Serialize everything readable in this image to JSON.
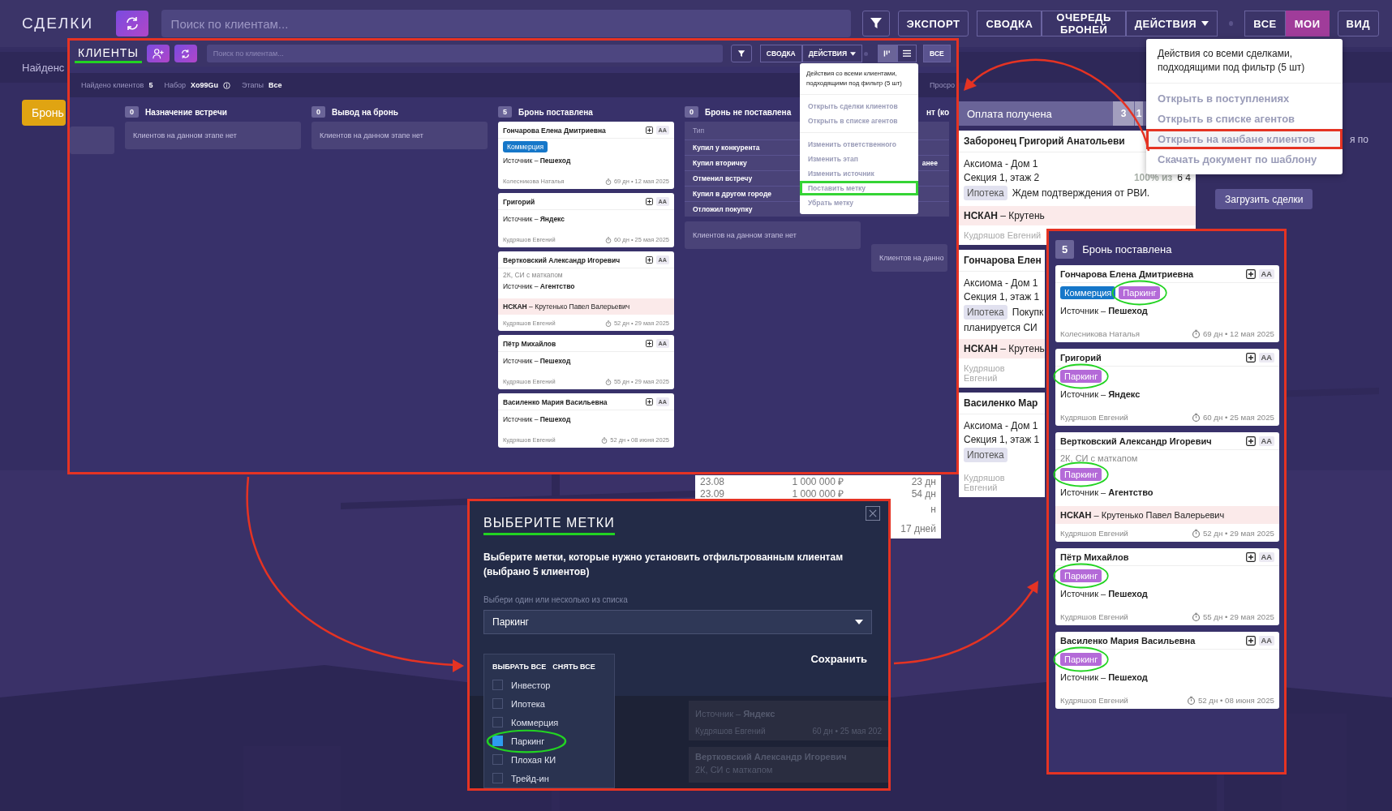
{
  "top_bar": {
    "title": "СДЕЛКИ",
    "search": {
      "placeholder": "Поиск по клиентам..."
    },
    "export": "ЭКСПОРТ",
    "group": [
      {
        "label": "СВОДКА",
        "kind": "plain"
      },
      {
        "label": "ОЧЕРЕДЬ БРОНЕЙ",
        "kind": "plain"
      },
      {
        "label": "ДЕЙСТВИЯ",
        "kind": "dropdown"
      }
    ],
    "scope_tabs": [
      {
        "label": "ВСЕ",
        "selected": false
      },
      {
        "label": "МОИ",
        "selected": true
      }
    ],
    "view": "ВИД"
  },
  "background": {
    "found_fragment": "Найденс",
    "stage_button": "Бронь",
    "side_fragment": "я по",
    "load_button": "Загрузить сделки",
    "payments": [
      [
        "23.08",
        "1 000 000 ₽",
        "23 дн"
      ],
      [
        "23.09",
        "1 000 000 ₽",
        "54 дн"
      ]
    ],
    "payments_fragment": "н",
    "payments_total": "17 дней"
  },
  "deals_menu": {
    "header": "Действия со всеми сделками, подходящими под фильтр (5 шт)",
    "items": [
      {
        "label": "Открыть в поступлениях",
        "highlighted": false
      },
      {
        "label": "Открыть в списке агентов",
        "highlighted": false
      },
      {
        "label": "Открыть на канбане клиентов",
        "highlighted": true
      },
      {
        "label": "Скачать документ по шаблону",
        "highlighted": false
      }
    ]
  },
  "deal_column": {
    "title": "Оплата получена",
    "counts": [
      "3",
      "1"
    ],
    "cards": [
      {
        "name": "Заборонец Григорий Анатольеви",
        "lines": [
          "Аксиома - Дом 1",
          "Секция 1, этаж 2"
        ],
        "progress": "100% из",
        "amount": "6 4",
        "tag": "Ипотека",
        "comment": "Ждем подтверждения от РВИ.",
        "nskan": "**НСКАН** – Крутень",
        "manager": "Кудряшов Евгений"
      },
      {
        "name": "Гончарова Елен",
        "lines": [
          "Аксиома - Дом 1",
          "Секция 1, этаж 1"
        ],
        "tag": "Ипотека",
        "comment": "Покупк",
        "comment_2": "планируется СИ",
        "nskan": "**НСКАН** – Крутень",
        "manager": "Кудряшов Евгений"
      },
      {
        "name": "Василенко Мар",
        "lines": [
          "Аксиома - Дом 1",
          "Секция 1, этаж 1"
        ],
        "tag": "Ипотека",
        "manager": "Кудряшов Евгений"
      }
    ]
  },
  "clients_panel": {
    "title": "КЛИЕНТЫ",
    "title_underlined": true,
    "search": {
      "placeholder": "Поиск по клиентам..."
    },
    "summary": "СВОДКА",
    "actions": "ДЕЙСТВИЯ",
    "view_toggle": [
      {
        "kind": "kanban",
        "selected": true
      },
      {
        "kind": "list",
        "selected": false
      }
    ],
    "scope": "ВСЕ",
    "info": [
      {
        "label": "Найдено клиентов",
        "value": "5"
      },
      {
        "label": "Набор",
        "value": "Xo99Gu",
        "info_icon": true
      },
      {
        "label": "Этапы",
        "value": "Все"
      }
    ],
    "info_fragment": "Просро",
    "menu": {
      "header": "Действия со всеми клиентами, подходящими под фильтр (5 шт)",
      "groups": [
        [
          {
            "label": "Открыть сделки клиентов",
            "highlighted": false
          },
          {
            "label": "Открыть в списке агентов",
            "highlighted": false
          }
        ],
        [
          {
            "label": "Изменить ответственного",
            "highlighted": false
          },
          {
            "label": "Изменить этап",
            "highlighted": false
          },
          {
            "label": "Изменить источник",
            "highlighted": false
          },
          {
            "label": "Поставить метку",
            "highlighted": true
          },
          {
            "label": "Убрать метку",
            "highlighted": false
          }
        ]
      ]
    },
    "columns": [
      {
        "count": "0",
        "title": "Назначение встречи",
        "empty": "Клиентов на данном этапе нет"
      },
      {
        "count": "0",
        "title": "Вывод на бронь",
        "empty": "Клиентов на данном этапе нет"
      },
      {
        "count": "5",
        "title": "Бронь поставлена",
        "cards": [
          {
            "name": "Гончарова Елена Дмитриевна",
            "initials": "AA",
            "tags": [
              {
                "label": "Коммерция",
                "color": "#1677c9",
                "circled": false
              }
            ],
            "source": "Источник – **Пешеход**",
            "manager": "Колесникова Наталья",
            "age": "69 дн • 12 мая 2025"
          },
          {
            "name": "Григорий",
            "initials": "AA",
            "source": "Источник – **Яндекс**",
            "manager": "Кудряшов Евгений",
            "age": "60 дн • 25 мая 2025"
          },
          {
            "name": "Вертковский Александр Игоревич",
            "initials": "AA",
            "note": "2К, СИ с маткапом",
            "source": "Источник – **Агентство**",
            "nskan": "**НСКАН** – Крутенько Павел Валерьевич",
            "manager": "Кудряшов Евгений",
            "age": "52 дн • 29 мая 2025"
          },
          {
            "name": "Пётр Михайлов",
            "initials": "AA",
            "source": "Источник – **Пешеход**",
            "manager": "Кудряшов Евгений",
            "age": "55 дн • 29 мая 2025"
          },
          {
            "name": "Василенко Мария Васильевна",
            "initials": "AA",
            "source": "Источник – **Пешеход**",
            "manager": "Кудряшов Евгений",
            "age": "52 дн • 08 июня 2025"
          }
        ]
      },
      {
        "count": "0",
        "title": "Бронь не поставлена",
        "empty": "Клиентов на данном этапе нет",
        "type_popup": {
          "header": "Тип",
          "items": [
            {
              "label": "Купил у конкурента"
            },
            {
              "label": "Купил вторичку",
              "extra": "анее"
            },
            {
              "label": "Отменил встречу"
            },
            {
              "label": "Купил в другом городе"
            },
            {
              "label": "Отложил покупку"
            }
          ]
        }
      },
      {
        "title": "нт (ко",
        "empty": "Клиентов на данно"
      }
    ]
  },
  "tags_modal": {
    "title": "ВЫБЕРИТЕ МЕТКИ",
    "title_underlined": true,
    "text": "Выберите метки, которые нужно установить отфильтрованным клиентам (выбрано 5 клиентов)",
    "label": "Выбери один или несколько из списка",
    "value": "Паркинг",
    "list_actions": [
      "ВЫБРАТЬ ВСЕ",
      "СНЯТЬ ВСЕ"
    ],
    "options": [
      {
        "label": "Инвестор",
        "checked": false,
        "circled": false
      },
      {
        "label": "Ипотека",
        "checked": false,
        "circled": false
      },
      {
        "label": "Коммерция",
        "checked": false,
        "circled": false
      },
      {
        "label": "Паркинг",
        "checked": true,
        "circled": true
      },
      {
        "label": "Плохая КИ",
        "checked": false,
        "circled": false
      },
      {
        "label": "Трейд-ин",
        "checked": false,
        "circled": false
      }
    ],
    "save": "Сохранить",
    "backdrop_cards": [
      {
        "source": "Источник – **Яндекс**",
        "manager": "Кудряшов Евгений",
        "age": "60 дн • 25 мая 202"
      },
      {
        "name": "Вертковский Александр Игоревич",
        "note": "2К, СИ с маткапом"
      }
    ]
  },
  "right_panel": {
    "count": "5",
    "title": "Бронь поставлена",
    "cards": [
      {
        "name": "Гончарова Елена Дмитриевна",
        "initials": "AA",
        "tags": [
          {
            "label": "Коммерция",
            "color": "#1677c9",
            "circled": false
          },
          {
            "label": "Паркинг",
            "color": "#b46ad8",
            "circled": true
          }
        ],
        "source": "Источник – **Пешеход**",
        "manager": "Колесникова Наталья",
        "age": "69 дн • 12 мая 2025"
      },
      {
        "name": "Григорий",
        "initials": "AA",
        "tags": [
          {
            "label": "Паркинг",
            "color": "#b46ad8",
            "circled": true
          }
        ],
        "source": "Источник – **Яндекс**",
        "manager": "Кудряшов Евгений",
        "age": "60 дн • 25 мая 2025"
      },
      {
        "name": "Вертковский Александр Игоревич",
        "initials": "AA",
        "note": "2К, СИ с маткапом",
        "tags": [
          {
            "label": "Паркинг",
            "color": "#b46ad8",
            "circled": true
          }
        ],
        "source": "Источник – **Агентство**",
        "nskan": "**НСКАН** – Крутенько Павел Валерьевич",
        "manager": "Кудряшов Евгений",
        "age": "52 дн • 29 мая 2025"
      },
      {
        "name": "Пётр Михайлов",
        "initials": "AA",
        "tags": [
          {
            "label": "Паркинг",
            "color": "#b46ad8",
            "circled": true
          }
        ],
        "source": "Источник – **Пешеход**",
        "manager": "Кудряшов Евгений",
        "age": "55 дн • 29 мая 2025"
      },
      {
        "name": "Василенко Мария Васильевна",
        "initials": "AA",
        "tags": [
          {
            "label": "Паркинг",
            "color": "#b46ad8",
            "circled": true
          }
        ],
        "source": "Источник – **Пешеход**",
        "manager": "Кудряшов Евгений",
        "age": "52 дн • 08 июня 2025"
      }
    ]
  }
}
